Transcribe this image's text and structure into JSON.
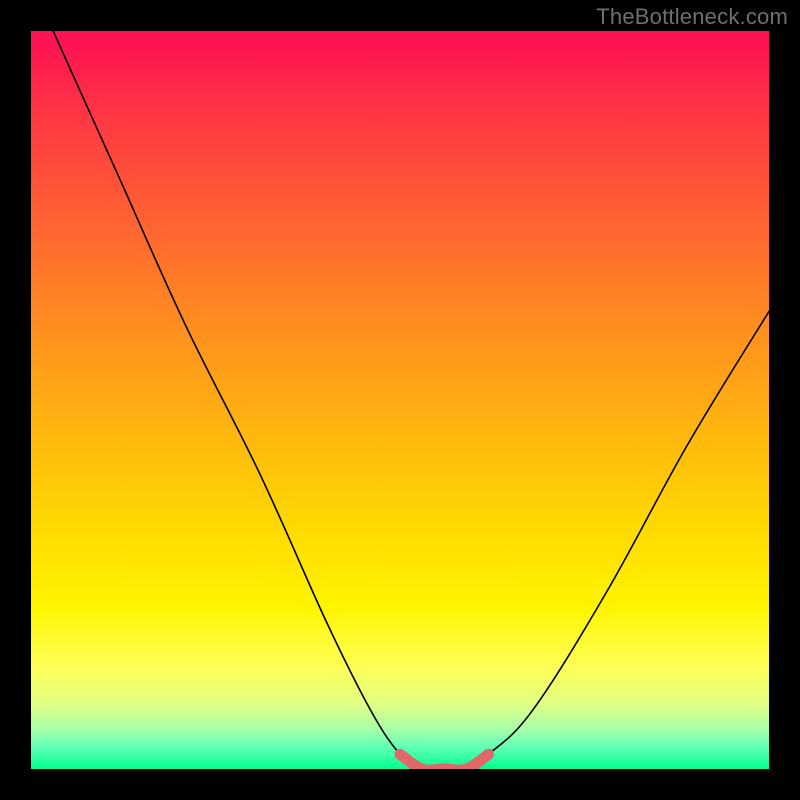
{
  "watermark": "TheBottleneck.com",
  "chart_data": {
    "type": "line",
    "title": "",
    "xlabel": "",
    "ylabel": "",
    "xlim": [
      0,
      100
    ],
    "ylim": [
      0,
      100
    ],
    "grid": false,
    "series": [
      {
        "name": "bottleneck-curve",
        "x": [
          3,
          12,
          21,
          31,
          40,
          46,
          50,
          53,
          56,
          59,
          62,
          68,
          78,
          89,
          100
        ],
        "values": [
          100,
          80,
          60,
          40,
          20,
          8,
          2,
          0,
          0,
          0,
          2,
          8,
          24,
          44,
          62
        ]
      }
    ],
    "highlight": {
      "name": "optimal-band",
      "x": [
        50,
        53,
        56,
        59,
        62
      ],
      "values": [
        2,
        0,
        0,
        0,
        2
      ],
      "color": "#e06868"
    },
    "background_gradient": {
      "top": "#ff1453",
      "bottom": "#00ff8e"
    }
  }
}
